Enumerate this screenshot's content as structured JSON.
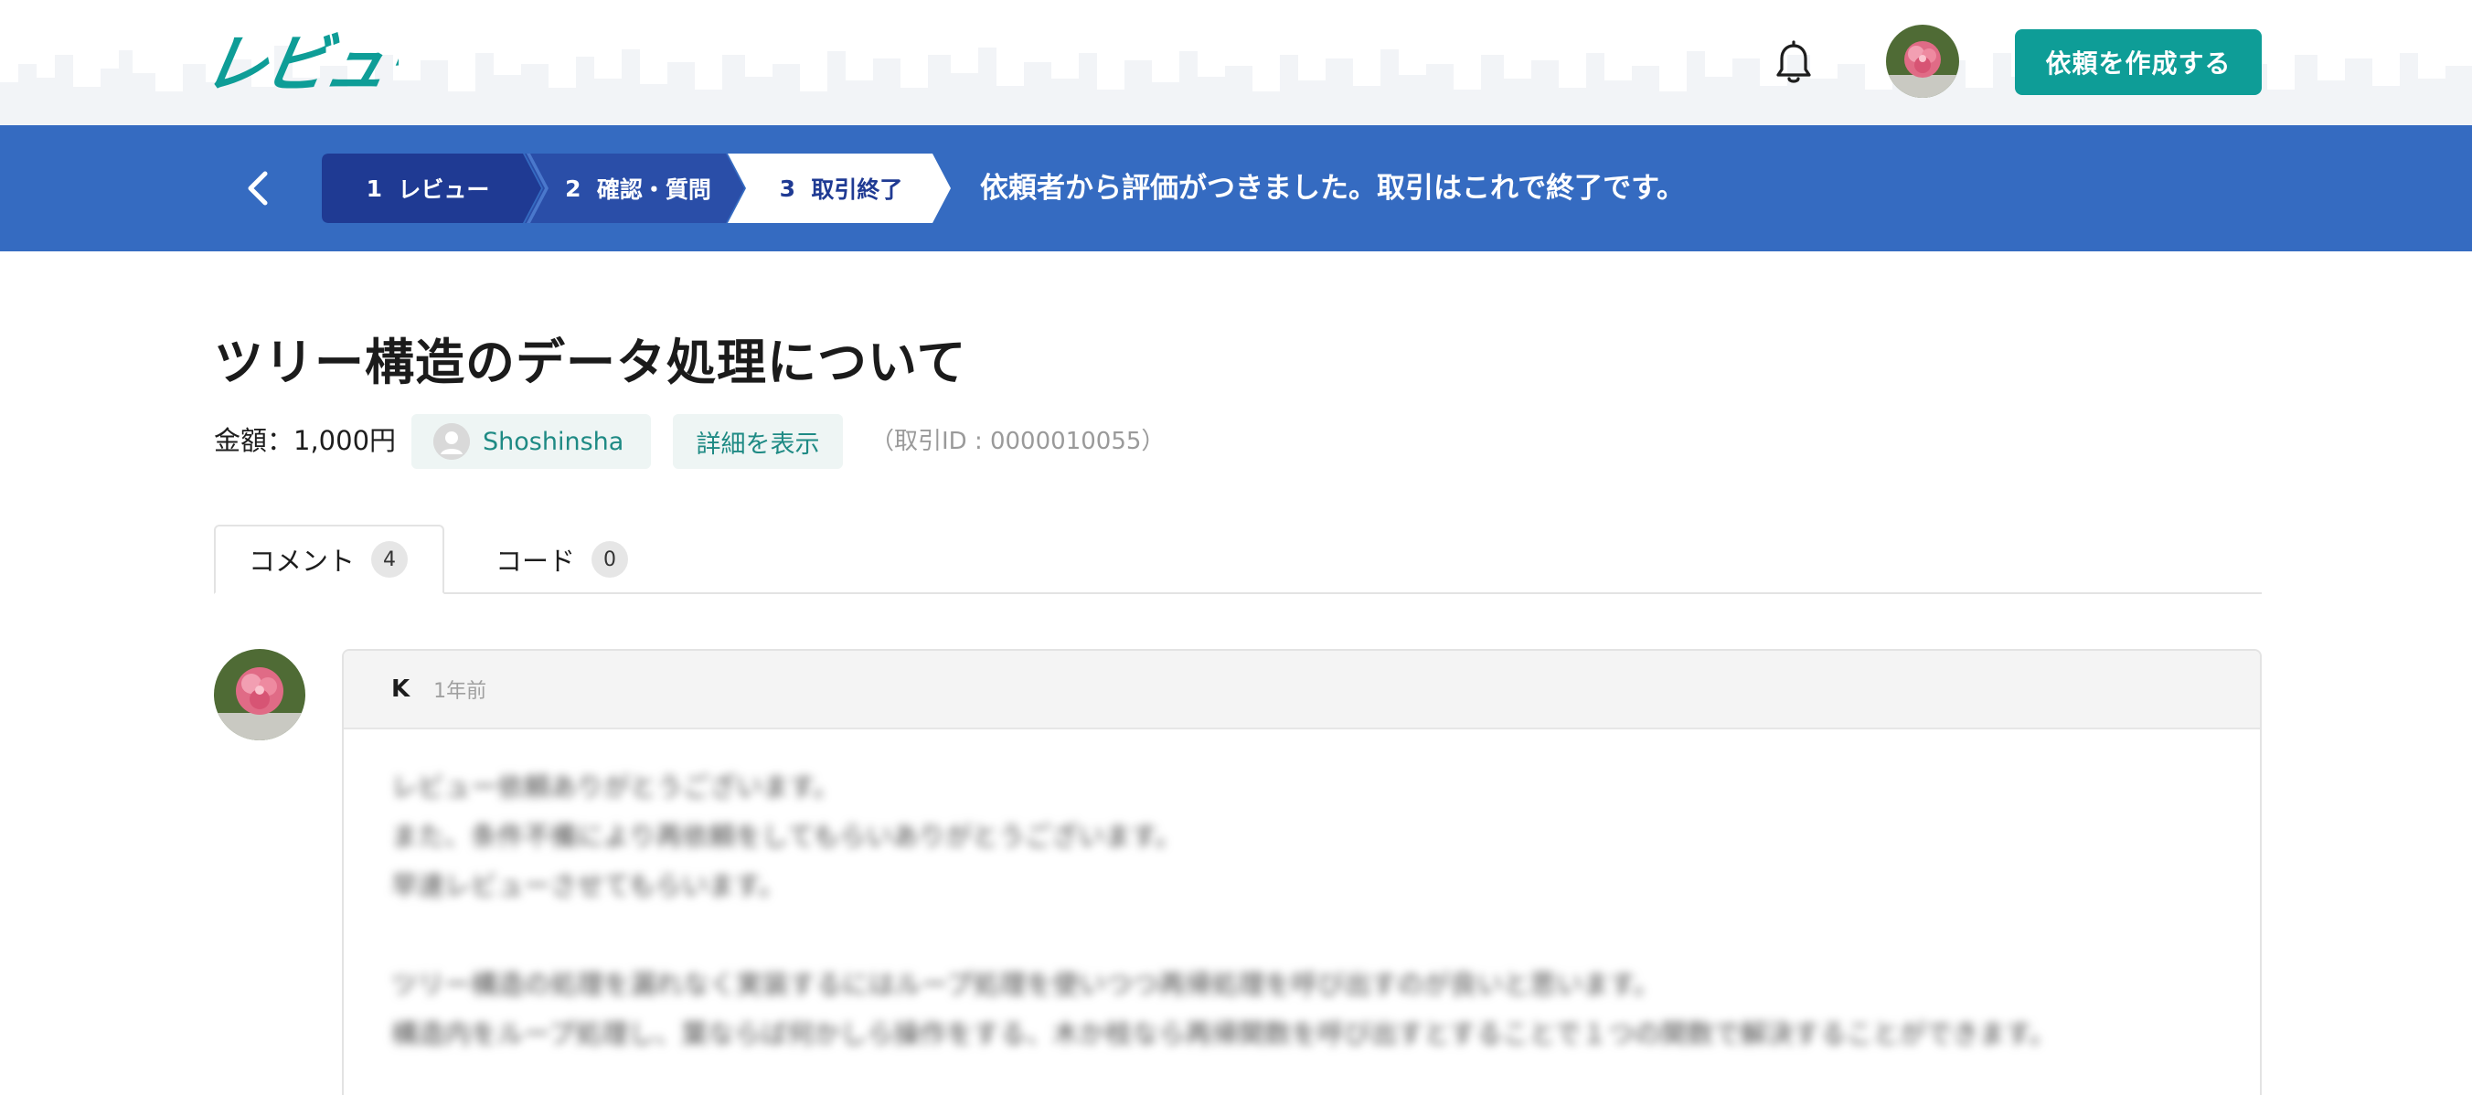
{
  "header": {
    "logo_text": "レビュー",
    "create_button": "依頼を作成する"
  },
  "progress": {
    "steps": [
      {
        "num": "1",
        "label": "レビュー"
      },
      {
        "num": "2",
        "label": "確認・質問"
      },
      {
        "num": "3",
        "label": "取引終了"
      }
    ],
    "message": "依頼者から評価がつきました。取引はこれで終了です。"
  },
  "request": {
    "title": "ツリー構造のデータ処理について",
    "amount": "金額：1,000円",
    "requester": "Shoshinsha",
    "detail_button": "詳細を表示",
    "transaction_id": "（取引ID : 0000010055）"
  },
  "tabs": [
    {
      "label": "コメント",
      "count": "4"
    },
    {
      "label": "コード",
      "count": "0"
    }
  ],
  "comment": {
    "author": "K",
    "time": "1年前",
    "lines": [
      "レビュー依頼ありがとうございます。",
      "また、条件不備により再依頼をしてもらいありがとうございます。",
      "早速レビューさせてもらいます。",
      "",
      "ツリー構造の処理を漏れなく実装するにはループ処理を使いつつ再帰処理を呼び出すのが良いと思います。",
      "構造内をループ処理し、葉ならば何かしら操作をする、木か枝なら再帰関数を呼び出すとすることで１つの関数で解決することができます。"
    ]
  },
  "colors": {
    "brand_teal": "#0e9d97",
    "band_blue": "#356bc1",
    "step_dark": "#1f3a93",
    "step_mid": "#2a4ea8"
  }
}
